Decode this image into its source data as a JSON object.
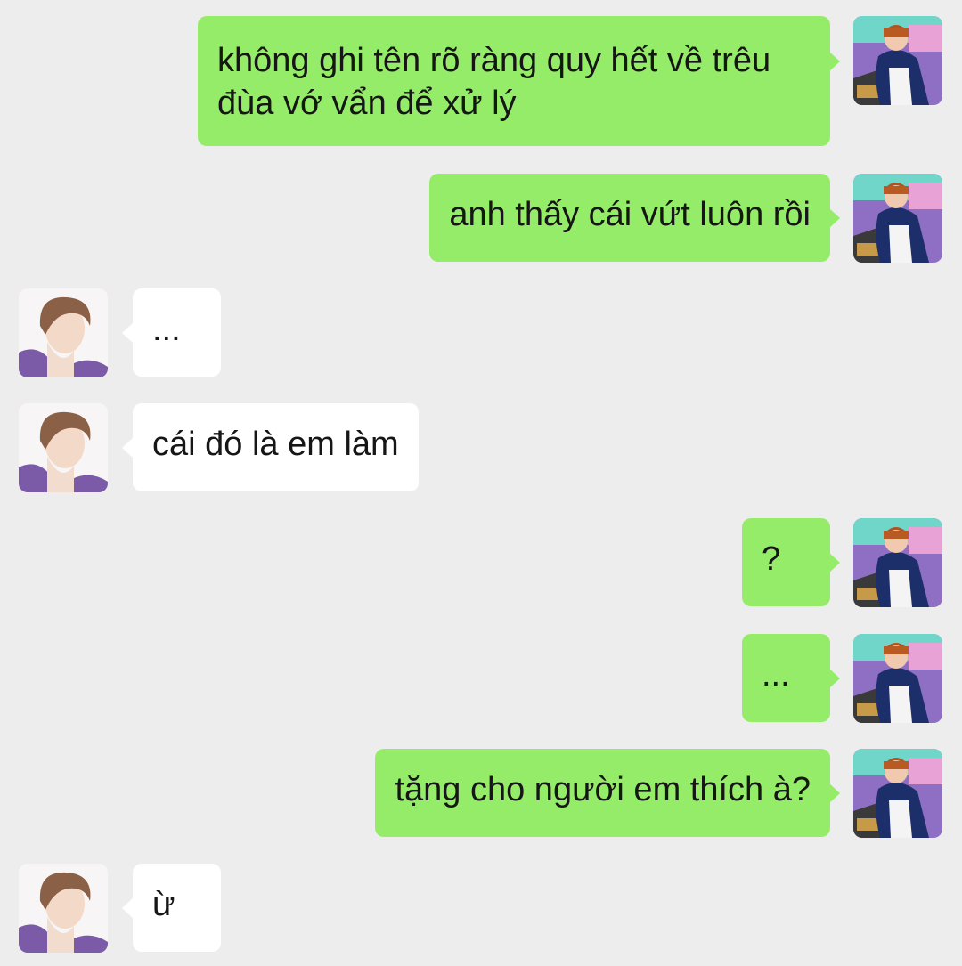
{
  "colors": {
    "background": "#ededed",
    "outgoing_bubble": "#95ec69",
    "incoming_bubble": "#ffffff",
    "text": "#161616"
  },
  "messages": [
    {
      "direction": "out",
      "text": "không ghi tên rõ ràng quy hết về trêu đùa vớ vẩn để xử lý",
      "avatar": "avatar-boy-beanie"
    },
    {
      "direction": "out",
      "text": "anh thấy cái vứt luôn rồi",
      "avatar": "avatar-boy-beanie"
    },
    {
      "direction": "in",
      "text": "...",
      "avatar": "avatar-boy-brown-hair"
    },
    {
      "direction": "in",
      "text": "cái đó là em làm",
      "avatar": "avatar-boy-brown-hair"
    },
    {
      "direction": "out",
      "text": "?",
      "avatar": "avatar-boy-beanie"
    },
    {
      "direction": "out",
      "text": "...",
      "avatar": "avatar-boy-beanie"
    },
    {
      "direction": "out",
      "text": "tặng cho người em thích à?",
      "avatar": "avatar-boy-beanie"
    },
    {
      "direction": "in",
      "text": "ừ",
      "avatar": "avatar-boy-brown-hair"
    }
  ]
}
